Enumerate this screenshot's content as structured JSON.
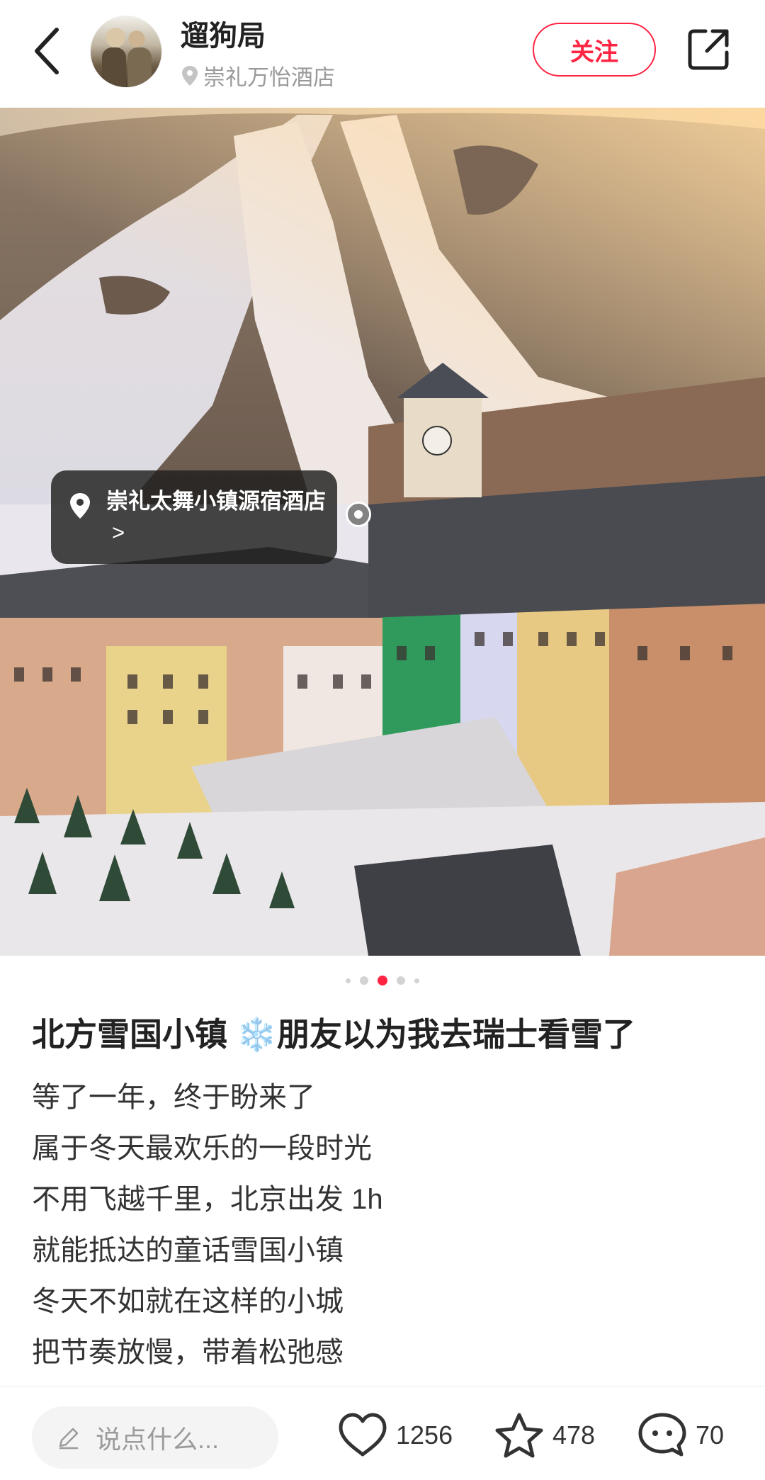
{
  "header": {
    "user_name": "遛狗局",
    "location": "崇礼万怡酒店",
    "follow_label": "关注"
  },
  "photo": {
    "poi_tag": "崇礼太舞小镇源宿酒店",
    "poi_chevron": ">",
    "carousel": {
      "total": 5,
      "current": 3
    }
  },
  "note": {
    "title": "北方雪国小镇 ❄️朋友以为我去瑞士看雪了",
    "lines": [
      "等了一年，终于盼来了",
      "属于冬天最欢乐的一段时光",
      "不用飞越千里，北京出发 1h",
      "就能抵达的童话雪国小镇",
      "冬天不如就在这样的小城",
      "把节奏放慢，带着松弛感"
    ]
  },
  "bottom_bar": {
    "comment_placeholder": "说点什么...",
    "likes": "1256",
    "collects": "478",
    "comments": "70"
  },
  "colors": {
    "accent": "#ff2442"
  }
}
